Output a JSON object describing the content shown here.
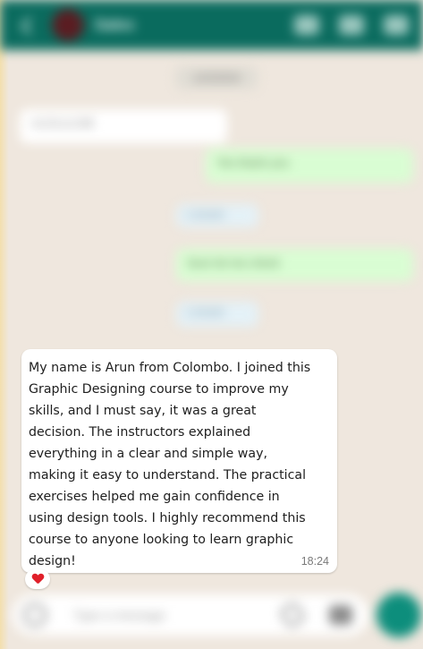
{
  "header": {
    "contact_name": "Sales"
  },
  "chat": {
    "date_chip": "12/3/2024",
    "incoming_first": "+1 3 1-1 3 8",
    "outgoing_first": "Yes thank you",
    "mini_one": "1 answer",
    "outgoing_second": "Sure let me check",
    "mini_two": "1 answer"
  },
  "message": {
    "text": "My name is Arun from Colombo. I joined this\nGraphic Designing course to improve my\nskills, and I must say, it was a great\ndecision. The instructors explained\neverything in a clear and simple way,\nmaking it easy to understand. The practical\nexercises helped me gain confidence in\nusing design tools. I highly recommend this\ncourse to anyone looking to learn graphic\ndesign!",
    "time": "18:24",
    "reaction": "heart"
  },
  "input": {
    "placeholder": "Type a message"
  },
  "colors": {
    "header": "#0a6b5e",
    "chat_bg": "#efe7de",
    "outgoing_bubble": "#d9fdd3",
    "send_button": "#0d8e7c",
    "reaction_heart": "#e0202a"
  },
  "icons": [
    "back-arrow-icon",
    "video-call-icon",
    "phone-icon",
    "emoji-icon",
    "attach-icon",
    "camera-icon",
    "mic-icon",
    "heart-icon"
  ]
}
